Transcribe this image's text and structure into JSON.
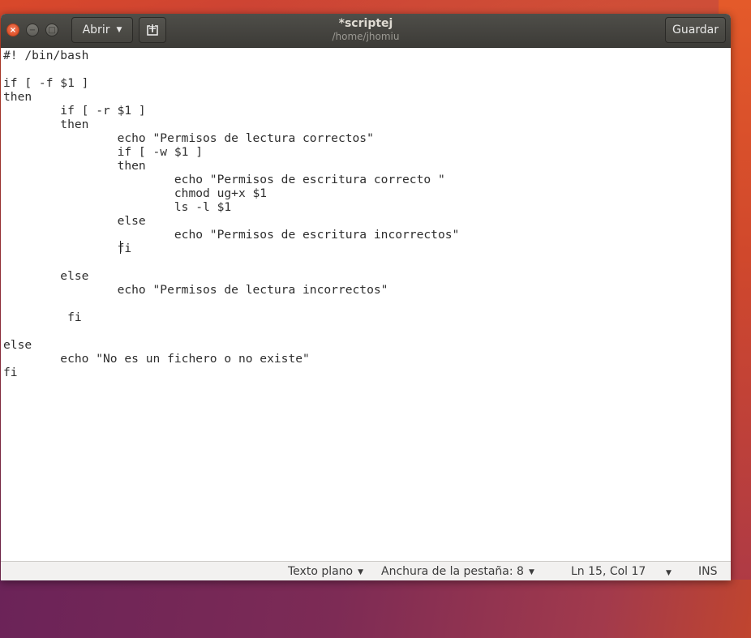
{
  "window": {
    "title": "*scriptej",
    "subtitle": "/home/jhomiu",
    "close_glyph": "×",
    "minimize_glyph": "−",
    "maximize_glyph": "□"
  },
  "toolbar": {
    "open_label": "Abrir",
    "open_caret": "▼",
    "new_tab_glyph": "⊞",
    "save_label": "Guardar"
  },
  "editor": {
    "lines": [
      "#! /bin/bash",
      "",
      "if [ -f $1 ]",
      "then",
      "        if [ -r $1 ]",
      "        then",
      "                echo \"Permisos de lectura correctos\"",
      "                if [ -w $1 ]",
      "                then",
      "                        echo \"Permisos de escritura correcto \"",
      "                        chmod ug+x $1",
      "                        ls -l $1",
      "                else",
      "                        echo \"Permisos de escritura incorrectos\"",
      "                fi",
      "",
      "        else",
      "                echo \"Permisos de lectura incorrectos\"",
      "",
      "         fi",
      "",
      "else",
      "        echo \"No es un fichero o no existe\"",
      "fi"
    ]
  },
  "statusbar": {
    "language": "Texto plano",
    "tab_width": "Anchura de la pestaña: 8",
    "position": "Ln 15, Col 17",
    "mode": "INS",
    "caret": "▼"
  },
  "colors": {
    "titlebar": "#3c3b37",
    "close_button": "#e0542c",
    "editor_bg": "#ffffff",
    "statusbar_bg": "#f2f1f0"
  }
}
